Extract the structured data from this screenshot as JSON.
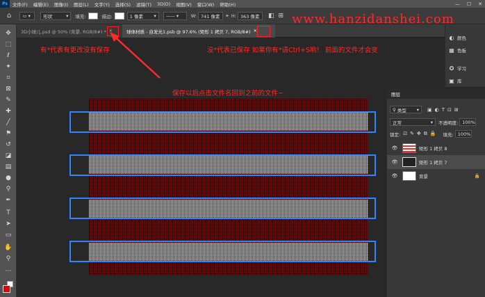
{
  "menu": {
    "app_logo": "Ps",
    "items": [
      "文件(F)",
      "编辑(E)",
      "图像(I)",
      "图层(L)",
      "文字(Y)",
      "选择(S)",
      "滤镜(T)",
      "3D(D)",
      "视图(V)",
      "窗口(W)",
      "帮助(H)"
    ],
    "win_controls": [
      "—",
      "☐",
      "✕"
    ]
  },
  "options": {
    "shape_mode": "形状",
    "fill_label": "填充:",
    "stroke_label": "描边:",
    "stroke_width": "1 像素",
    "w_label": "W:",
    "w_value": "741 像素",
    "h_label": "H:",
    "h_value": "363 像素"
  },
  "watermark": "www.hanzidanshei.com",
  "tabs": [
    {
      "label": "3D小球儿.psd @ 50% (背景, RGB/8#) *",
      "close": "✕"
    },
    {
      "label": "球体材质 - 自发光1.psb @ 97.6% (矩形 1 拷贝 7, RGB/8#)",
      "close": "✕"
    }
  ],
  "annotations": {
    "left": "有*代表有更改没有保存",
    "right": "没*代表已保存  如果你有*请Ctrl+S哟！  前面的文件才会变",
    "center": "保存以后点击文件名回到之前的文件~"
  },
  "right_panel": {
    "items": [
      {
        "icon": "color-icon",
        "label": "颜色"
      },
      {
        "icon": "swatches-icon",
        "label": "色板"
      },
      {
        "icon": "learn-icon",
        "label": "学习"
      },
      {
        "icon": "libraries-icon",
        "label": "库"
      }
    ]
  },
  "layers_panel": {
    "title": "图层",
    "filter_kind": "类型",
    "blend_mode": "正常",
    "opacity_label": "不透明度:",
    "opacity_value": "100%",
    "lock_label": "锁定:",
    "fill_label": "填充:",
    "fill_value": "100%",
    "layers": [
      {
        "name": "矩形 1 拷贝 8",
        "selected": false,
        "thumb": "red"
      },
      {
        "name": "矩形 1 拷贝 7",
        "selected": true,
        "thumb": "dark"
      },
      {
        "name": "背景",
        "selected": false,
        "thumb": "white"
      }
    ]
  },
  "colors": {
    "accent_red": "#ff2a2a",
    "selection_blue": "#2f86ff",
    "foreground": "#e60000",
    "background": "#ffffff"
  }
}
